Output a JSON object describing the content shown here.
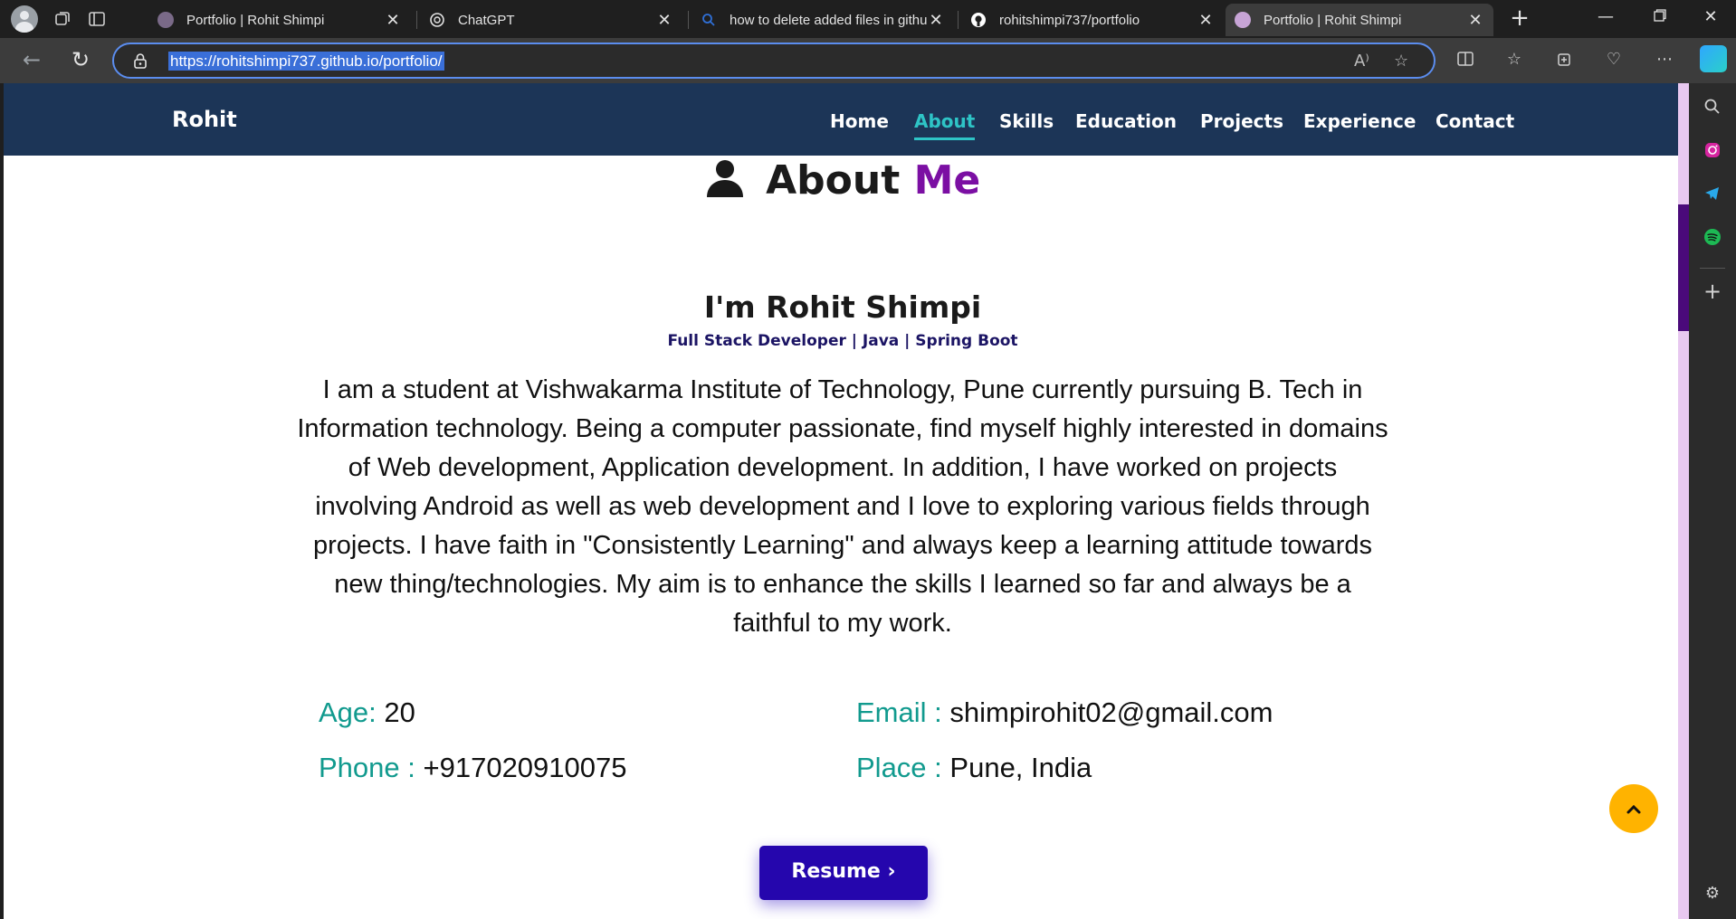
{
  "browser": {
    "tabs": [
      {
        "title": "Portfolio | Rohit Shimpi",
        "favicon_color": "#7a6a88",
        "active": false
      },
      {
        "title": "ChatGPT",
        "favicon_color": "#e3e3e3",
        "active": false
      },
      {
        "title": "how to delete added files in githu",
        "favicon_color": "#2f6fd6",
        "active": false
      },
      {
        "title": "rohitshimpi737/portfolio",
        "favicon_color": "#ffffff",
        "active": false
      },
      {
        "title": "Portfolio | Rohit Shimpi",
        "favicon_color": "#c7a4d6",
        "active": true
      }
    ],
    "url": "https://rohitshimpi737.github.io/portfolio/"
  },
  "site": {
    "brand": "Rohit",
    "nav": [
      "Home",
      "About",
      "Skills",
      "Education",
      "Projects",
      "Experience",
      "Contact"
    ],
    "active_nav": "About"
  },
  "about": {
    "heading_main": "About",
    "heading_accent": "Me",
    "name": "I'm Rohit Shimpi",
    "tagline": "Full Stack Developer | Java | Spring Boot",
    "bio_lines": [
      "I am a student at Vishwakarma Institute of Technology, Pune currently pursuing B. Tech in",
      "Information technology. Being a computer passionate, find myself highly interested in domains",
      "of Web development, Application development. In addition, I have worked on projects",
      "involving Android as well as web development and I love to exploring various fields through",
      "projects. I have faith in \"Consistently Learning\" and always keep a learning attitude towards",
      "new thing/technologies. My aim is to enhance the skills I learned so far and always be a",
      "faithful to my work."
    ],
    "age_label": "Age:",
    "age_value": "20",
    "email_label": "Email :",
    "email_value": "shimpirohit02@gmail.com",
    "phone_label": "Phone :",
    "phone_value": "+917020910075",
    "place_label": "Place :",
    "place_value": "Pune, India",
    "resume_label": "Resume",
    "resume_icon": "chevron-right-icon",
    "back_to_top_icon": "chevron-up-icon"
  },
  "colors": {
    "navbar_bg": "#1c3557",
    "active_nav": "#2ec4c6",
    "accent_purple": "#7b0fa3",
    "label_teal": "#119a8e",
    "resume_bg": "#2506ad",
    "top_button": "#ffb300"
  }
}
